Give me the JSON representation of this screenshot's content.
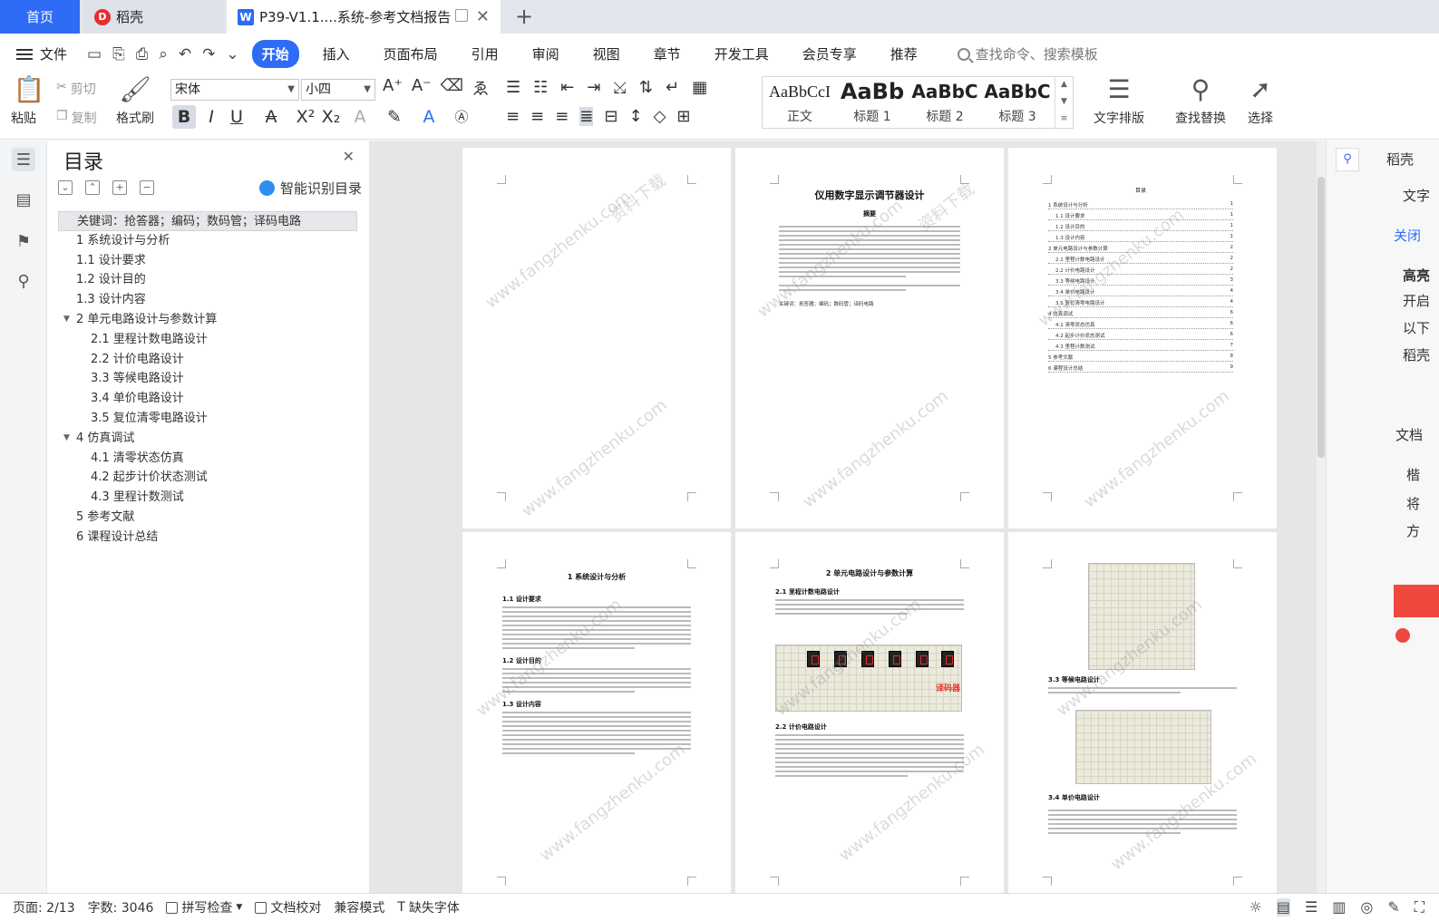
{
  "tabs": {
    "home": "首页",
    "daoke": "稻壳",
    "doc": "P39-V1.1....系统-参考文档报告"
  },
  "menu": {
    "file": "文件",
    "items": [
      "开始",
      "插入",
      "页面布局",
      "引用",
      "审阅",
      "视图",
      "章节",
      "开发工具",
      "会员专享",
      "推荐"
    ],
    "active": "开始",
    "search_placeholder": "查找命令、搜索模板"
  },
  "ribbon": {
    "paste": "粘贴",
    "cut": "剪切",
    "copy": "复制",
    "format_painter": "格式刷",
    "font_name": "宋体",
    "font_size": "小四",
    "styles": [
      {
        "sample": "AaBbCcI",
        "name": "正文"
      },
      {
        "sample": "AaBb",
        "name": "标题 1"
      },
      {
        "sample": "AaBbC",
        "name": "标题 2"
      },
      {
        "sample": "AaBbC",
        "name": "标题 3"
      }
    ],
    "text_layout": "文字排版",
    "find_replace": "查找替换",
    "select": "选择"
  },
  "toc_panel": {
    "title": "目录",
    "smart_toc": "智能识别目录",
    "items": [
      {
        "text": "关键词：抢答器；编码；数码管；译码电路",
        "level": 1,
        "selected": true
      },
      {
        "text": "1 系统设计与分析",
        "level": 1
      },
      {
        "text": "1.1  设计要求",
        "level": 1
      },
      {
        "text": "1.2  设计目的",
        "level": 1
      },
      {
        "text": "1.3  设计内容",
        "level": 1
      },
      {
        "text": "2  单元电路设计与参数计算",
        "level": 1,
        "expanded": true
      },
      {
        "text": "2.1 里程计数电路设计",
        "level": 2
      },
      {
        "text": "2.2  计价电路设计",
        "level": 2
      },
      {
        "text": "3.3  等候电路设计",
        "level": 2
      },
      {
        "text": "3.4  单价电路设计",
        "level": 2
      },
      {
        "text": "3.5  复位清零电路设计",
        "level": 2
      },
      {
        "text": "4  仿真调试",
        "level": 1,
        "expanded": true
      },
      {
        "text": "4.1  清零状态仿真",
        "level": 2
      },
      {
        "text": "4.2  起步计价状态测试",
        "level": 2
      },
      {
        "text": "4.3  里程计数测试",
        "level": 2
      },
      {
        "text": "5  参考文献",
        "level": 1
      },
      {
        "text": "6  课程设计总结",
        "level": 1
      }
    ]
  },
  "pages": {
    "p2_title": "仪用数字显示调节器设计",
    "p2_abstract": "摘要",
    "p2_keywords": "关键词：抢答器；编码；数码管；译码电路",
    "p3_title": "目录",
    "p3_rows": [
      {
        "t": "1 系统设计与分析",
        "p": "1"
      },
      {
        "t": "1.1 设计要求",
        "p": "1"
      },
      {
        "t": "1.2 设计目的",
        "p": "1"
      },
      {
        "t": "1.3 设计内容",
        "p": "1"
      },
      {
        "t": "2 单元电路设计与参数计算",
        "p": "2"
      },
      {
        "t": "2.1 里程计数电路设计",
        "p": "2"
      },
      {
        "t": "2.2 计价电路设计",
        "p": "2"
      },
      {
        "t": "3.3 等候电路设计",
        "p": "3"
      },
      {
        "t": "3.4 单价电路设计",
        "p": "4"
      },
      {
        "t": "3.5 复位清零电路设计",
        "p": "4"
      },
      {
        "t": "4 仿真调试",
        "p": "6"
      },
      {
        "t": "4.1 清零状态仿真",
        "p": "6"
      },
      {
        "t": "4.2 起步计价状态测试",
        "p": "6"
      },
      {
        "t": "4.3 里程计数测试",
        "p": "7"
      },
      {
        "t": "5 参考文献",
        "p": "8"
      },
      {
        "t": "6 课程设计总结",
        "p": "9"
      }
    ],
    "p4_title": "1 系统设计与分析",
    "p4_h1": "1.1  设计要求",
    "p4_h2": "1.2  设计目的",
    "p4_h3": "1.3  设计内容",
    "p5_title": "2  单元电路设计与参数计算",
    "p5_h1": "2.1 里程计数电路设计",
    "p5_h2": "2.2  计价电路设计",
    "p5_decoder": "译码器",
    "p6_h1": "3.3  等候电路设计",
    "p6_h2": "3.4  单价电路设计"
  },
  "watermark": {
    "line1": "资料下载",
    "line2": "www.fangzhenku.com"
  },
  "right_panel": {
    "title": "稻壳",
    "t1": "文字",
    "t2": "关闭",
    "t3": "高亮",
    "t4": "开启",
    "t5": "以下",
    "t6": "稻壳",
    "t7": "文档",
    "t8": "楷",
    "t9": "将",
    "t10": "方"
  },
  "status": {
    "page": "页面: 2/13",
    "words": "字数: 3046",
    "spell": "拼写检查",
    "proof": "文档校对",
    "compat": "兼容模式",
    "missing_font": "缺失字体"
  }
}
